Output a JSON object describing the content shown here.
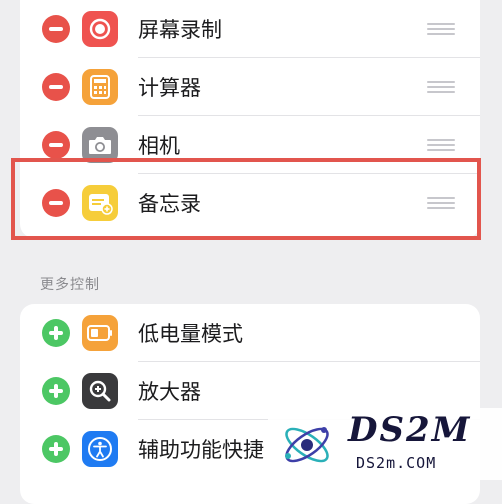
{
  "included_controls": [
    {
      "label": "屏幕录制",
      "icon": "screen-record-icon",
      "icon_color": "#ef5350"
    },
    {
      "label": "计算器",
      "icon": "calculator-icon",
      "icon_color": "#f5a23a"
    },
    {
      "label": "相机",
      "icon": "camera-icon",
      "icon_color": "#8e8e93"
    },
    {
      "label": "备忘录",
      "icon": "notes-icon",
      "icon_color": "#f6cd3a"
    }
  ],
  "more_controls": {
    "header": "更多控制",
    "items": [
      {
        "label": "低电量模式",
        "icon": "low-power-mode-icon",
        "icon_color": "#f5a23a"
      },
      {
        "label": "放大器",
        "icon": "magnifier-icon",
        "icon_color": "#3a3a3c"
      },
      {
        "label": "辅助功能快捷",
        "icon": "accessibility-shortcut-icon",
        "icon_color": "#1f7bf2"
      }
    ]
  },
  "colors": {
    "remove": "#e8524a",
    "add": "#4cc764",
    "highlight": "#e2554d"
  },
  "watermark": {
    "title": "DS2M",
    "url": "DS2m.COM"
  }
}
